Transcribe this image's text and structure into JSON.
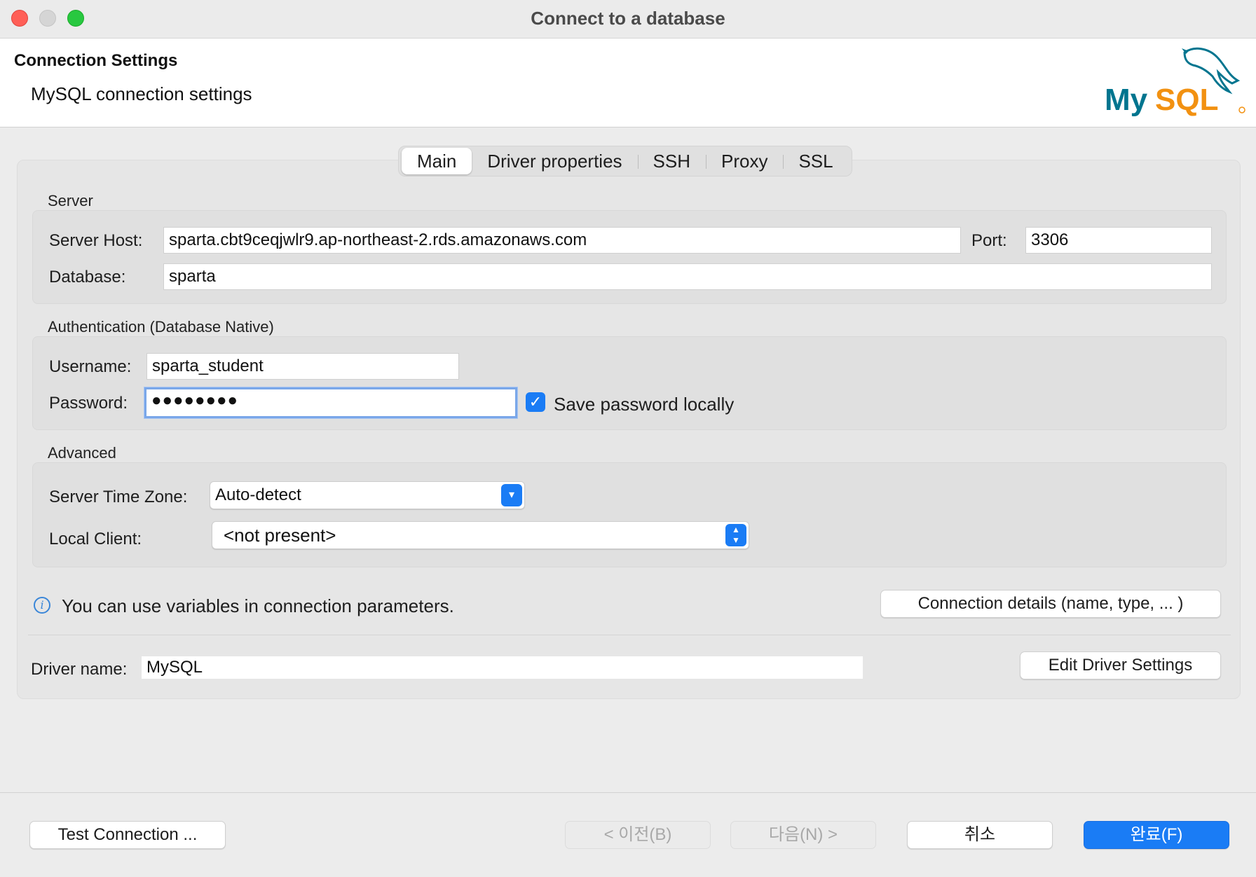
{
  "window": {
    "title": "Connect to a database"
  },
  "header": {
    "title": "Connection Settings",
    "subtitle": "MySQL connection settings",
    "logo_text": "MySQL"
  },
  "tabs": [
    {
      "label": "Main",
      "active": true
    },
    {
      "label": "Driver properties",
      "active": false
    },
    {
      "label": "SSH",
      "active": false
    },
    {
      "label": "Proxy",
      "active": false
    },
    {
      "label": "SSL",
      "active": false
    }
  ],
  "server": {
    "group_label": "Server",
    "host_label": "Server Host:",
    "host_value": "sparta.cbt9ceqjwlr9.ap-northeast-2.rds.amazonaws.com",
    "port_label": "Port:",
    "port_value": "3306",
    "database_label": "Database:",
    "database_value": "sparta"
  },
  "auth": {
    "group_label": "Authentication (Database Native)",
    "username_label": "Username:",
    "username_value": "sparta_student",
    "password_label": "Password:",
    "password_value": "●●●●●●●●",
    "save_password_label": "Save password locally",
    "save_password_checked": true
  },
  "advanced": {
    "group_label": "Advanced",
    "timezone_label": "Server Time Zone:",
    "timezone_value": "Auto-detect",
    "local_client_label": "Local Client:",
    "local_client_value": "<not present>"
  },
  "info": {
    "variables_text": "You can use variables in connection parameters.",
    "connection_details_button": "Connection details (name, type, ... )"
  },
  "driver": {
    "label": "Driver name:",
    "value": "MySQL",
    "edit_button": "Edit Driver Settings"
  },
  "footer": {
    "test_button": "Test Connection ...",
    "back_button": "< 이전(B)",
    "next_button": "다음(N) >",
    "cancel_button": "취소",
    "finish_button": "완료(F)"
  },
  "colors": {
    "accent": "#1a7cf5",
    "focus_ring": "#7aa7e9",
    "logo_blue": "#00758f",
    "logo_orange": "#f29111"
  }
}
